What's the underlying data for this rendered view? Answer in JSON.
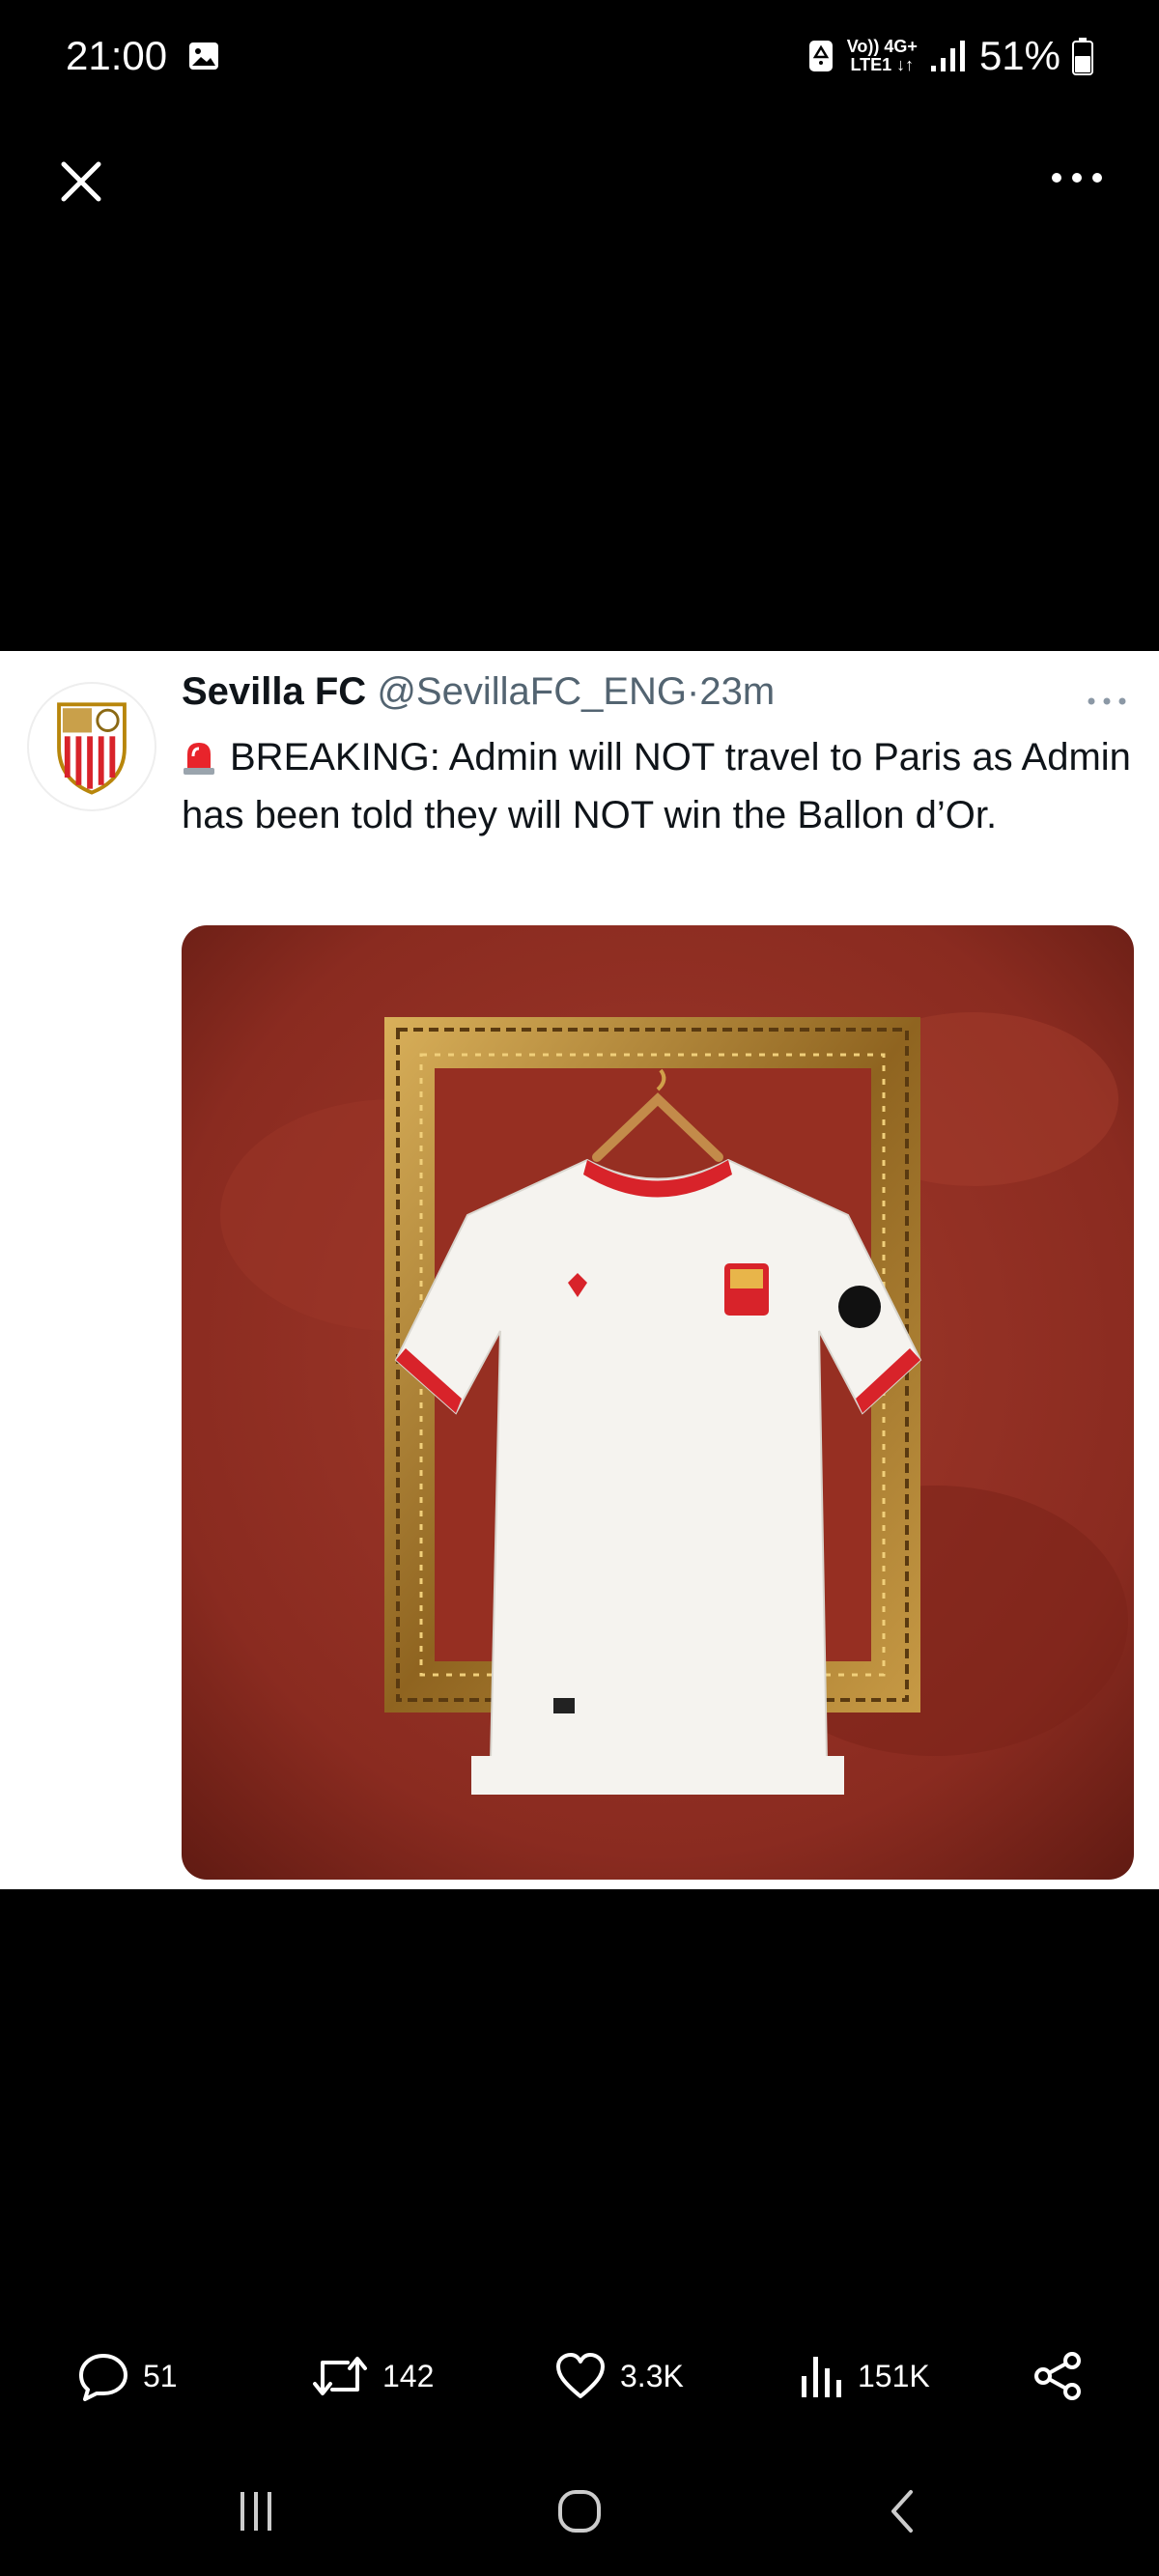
{
  "status_bar": {
    "time": "21:00",
    "network_label_top": "Vo)) 4G+",
    "network_label_bottom": "LTE1 ↓↑",
    "battery_percent": "51%",
    "icons": [
      "gallery-icon",
      "data-saver-icon",
      "signal-icon",
      "battery-icon"
    ]
  },
  "top_bar": {
    "close_icon": "close-icon",
    "more_icon": "more-options-icon"
  },
  "tweet": {
    "author_name": "Sevilla FC",
    "handle": "@SevillaFC_ENG",
    "separator": "·",
    "time_ago": "23m",
    "text": "BREAKING: Admin will NOT travel to Paris as Admin has been told they will NOT win the Ballon d’Or.",
    "emoji_icon": "rotating-light-icon",
    "media_icon": "photo-sevilla-kit-in-frame"
  },
  "actions": {
    "replies": "51",
    "retweets": "142",
    "likes": "3.3K",
    "views": "151K",
    "icons": [
      "reply-icon",
      "retweet-icon",
      "like-icon",
      "views-icon",
      "share-icon"
    ]
  },
  "nav_bar": {
    "icons": [
      "recent-apps-icon",
      "home-icon",
      "back-icon"
    ]
  },
  "colors": {
    "background": "#000000",
    "card": "#ffffff",
    "name": "#0f1419",
    "secondary": "#536471",
    "sevilla_red": "#d8232a"
  }
}
